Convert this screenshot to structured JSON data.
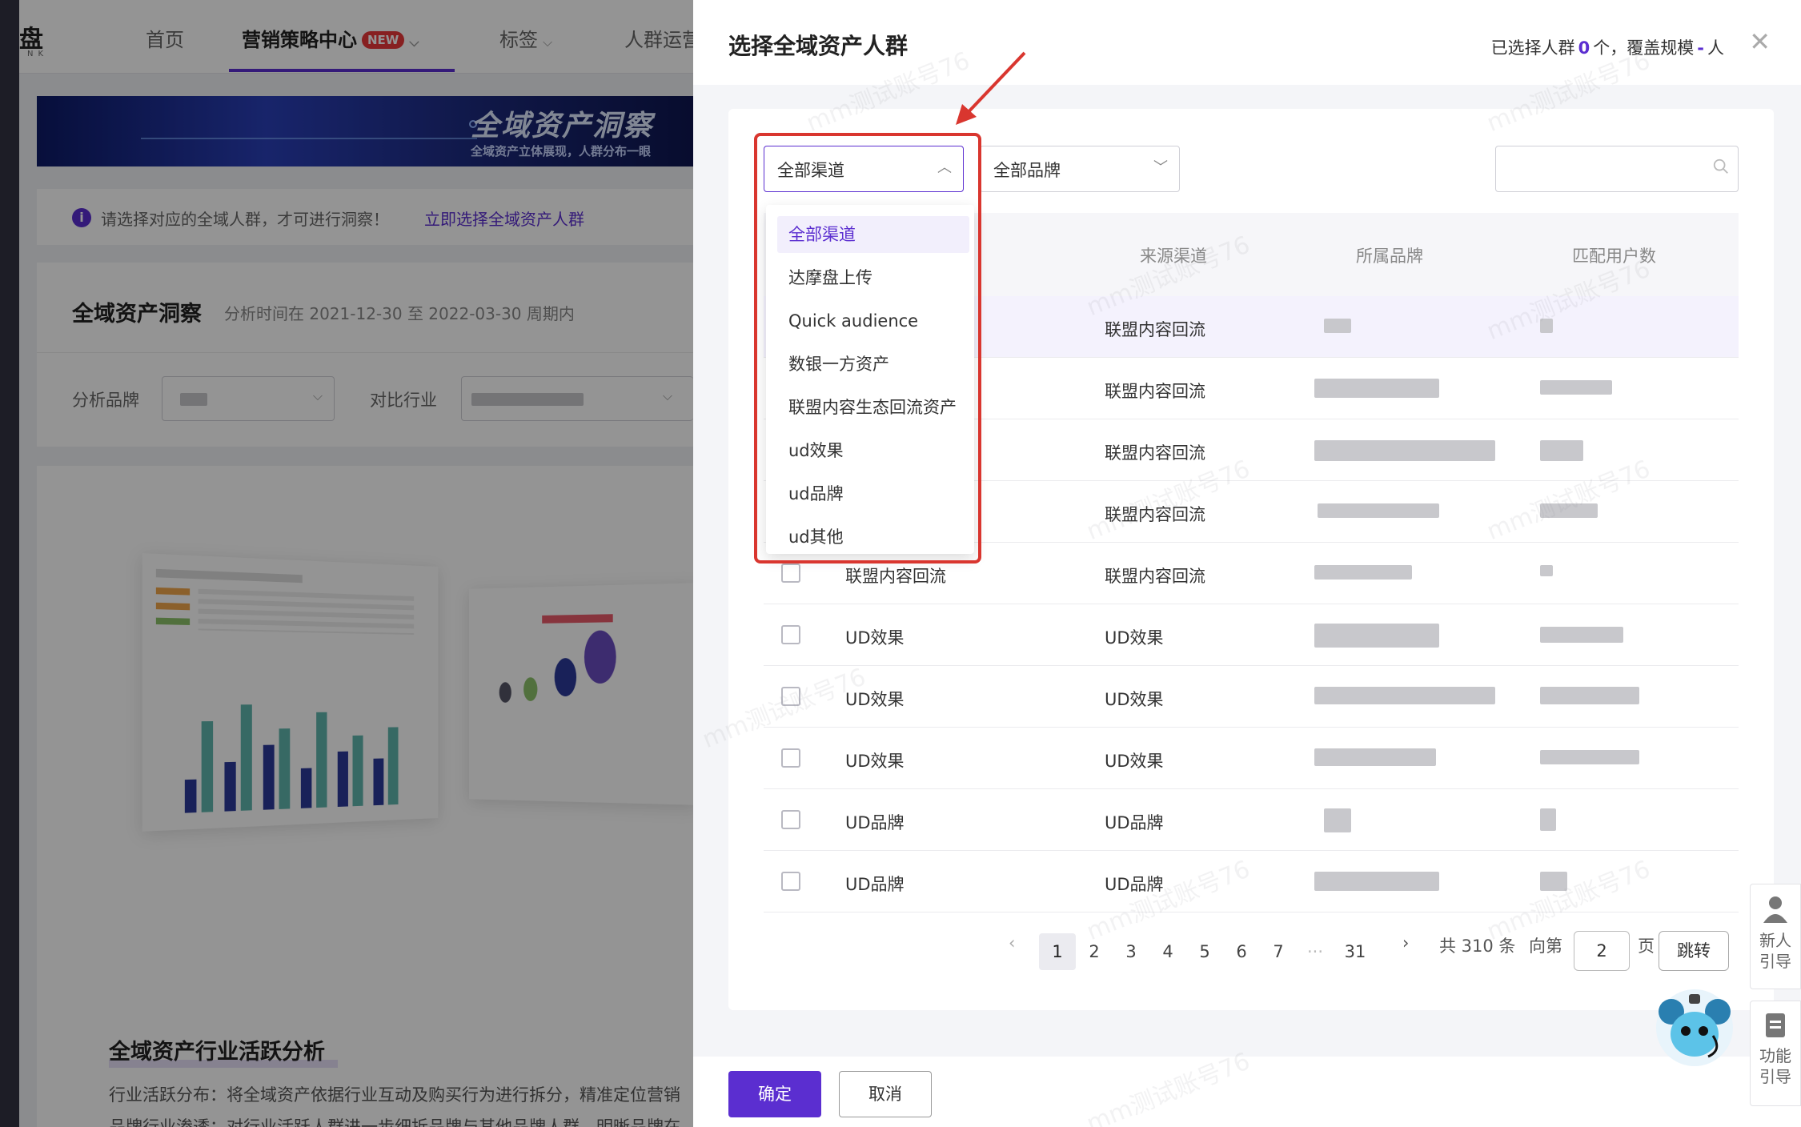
{
  "background": {
    "logo": "盘",
    "logo_sub": "NK",
    "nav": [
      {
        "label": "首页"
      },
      {
        "label": "营销策略中心",
        "badge": "NEW"
      },
      {
        "label": "标签"
      },
      {
        "label": "人群运营"
      }
    ],
    "banner": {
      "title": "全域资产洞察",
      "subtitle": "全域资产立体展现，人群分布一眼"
    },
    "notice": {
      "text": "请选择对应的全域人群，才可进行洞察！",
      "link": "立即选择全域资产人群"
    },
    "insight": {
      "title": "全域资产洞察",
      "subtitle": "分析时间在 2021-12-30 至 2022-03-30 周期内",
      "brand_label": "分析品牌",
      "industry_label": "对比行业"
    },
    "activity": {
      "title": "全域资产行业活跃分析",
      "line1": "行业活跃分布：将全域资产依据行业互动及购买行为进行拆分，精准定位营销",
      "line2": "品牌行业渗透：对行业活跃人群进一步细拆品牌与其他品牌人群，明晰品牌在"
    }
  },
  "drawer": {
    "title": "选择全域资产人群",
    "summary": {
      "prefix": "已选择人群",
      "count": "0",
      "middle": "个，覆盖规模",
      "scale": "-",
      "unit": "人"
    },
    "filters": {
      "channel": "全部渠道",
      "brand": "全部品牌",
      "search_placeholder": ""
    },
    "table": {
      "headers": {
        "source": "来源渠道",
        "brand": "所属品牌",
        "users": "匹配用户数"
      },
      "rows": [
        {
          "name": "",
          "source": "联盟内容回流"
        },
        {
          "name": "",
          "source": "联盟内容回流"
        },
        {
          "name": "",
          "source": "联盟内容回流"
        },
        {
          "name": "",
          "source": "联盟内容回流"
        },
        {
          "name": "联盟内容回流",
          "source": "联盟内容回流"
        },
        {
          "name": "UD效果",
          "source": "UD效果"
        },
        {
          "name": "UD效果",
          "source": "UD效果"
        },
        {
          "name": "UD效果",
          "source": "UD效果"
        },
        {
          "name": "UD品牌",
          "source": "UD品牌"
        },
        {
          "name": "UD品牌",
          "source": "UD品牌"
        }
      ]
    },
    "dropdown": {
      "options": [
        "全部渠道",
        "达摩盘上传",
        "Quick audience",
        "数银一方资产",
        "联盟内容生态回流资产",
        "ud效果",
        "ud品牌",
        "ud其他"
      ],
      "selected_index": 0
    },
    "pagination": {
      "prev": "‹",
      "pages": [
        "1",
        "2",
        "3",
        "4",
        "5",
        "6",
        "7",
        "···",
        "31"
      ],
      "current": "1",
      "next": "›",
      "total": "共 310 条",
      "goto_prefix": "向第",
      "goto_value": "2",
      "goto_suffix": "页",
      "jump": "跳转"
    },
    "footer": {
      "confirm": "确定",
      "cancel": "取消"
    }
  },
  "side_widgets": {
    "newbie": "新人引导",
    "feature": "功能引导"
  },
  "watermark": "mm测试账号76",
  "colors": {
    "accent": "#5b2ed0",
    "highlight": "#d9362f",
    "badge": "#e8373a"
  }
}
